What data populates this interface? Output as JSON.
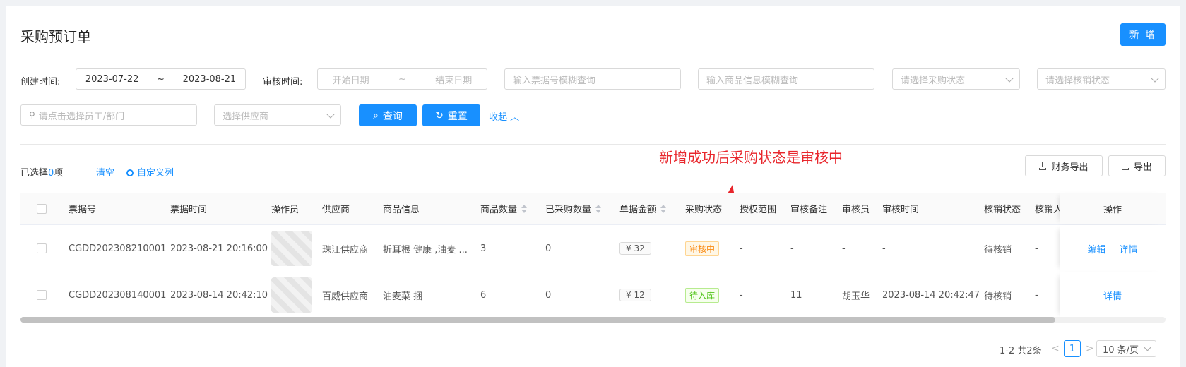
{
  "header": {
    "title": "采购预订单",
    "new_button": "新 增"
  },
  "filters": {
    "created_label": "创建时间:",
    "created_start": "2023-07-22",
    "created_end": "2023-08-21",
    "range_sep": "~",
    "audit_label": "审核时间:",
    "audit_start_placeholder": "开始日期",
    "audit_end_placeholder": "结束日期",
    "ticket_placeholder": "输入票据号模糊查询",
    "goods_placeholder": "输入商品信息模糊查询",
    "purchase_status_placeholder": "请选择采购状态",
    "writeoff_status_placeholder": "请选择核销状态",
    "employee_placeholder": "请点击选择员工/部门",
    "supplier_placeholder": "选择供应商",
    "query_button": "查询",
    "reset_button": "重置",
    "collapse_link": "收起"
  },
  "annotation": "新增成功后采购状态是审核中",
  "toolbar": {
    "selected_prefix": "已选择",
    "selected_count": "0",
    "selected_suffix": "项",
    "clear_link": "清空",
    "custom_columns_link": "自定义列",
    "finance_export_button": "财务导出",
    "export_button": "导出"
  },
  "table": {
    "columns": [
      "票据号",
      "票据时间",
      "操作员",
      "供应商",
      "商品信息",
      "商品数量",
      "已采购数量",
      "单据金额",
      "采购状态",
      "授权范围",
      "审核备注",
      "审核员",
      "审核时间",
      "核销状态",
      "核销人",
      "操作"
    ],
    "rows": [
      {
        "ticket": "CGDD202308210001",
        "time": "2023-08-21 20:16:00",
        "supplier": "珠江供应商",
        "goods": "折耳根 健康 ,油麦 ...",
        "qty": "3",
        "purchased": "0",
        "amount": "¥ 32",
        "status": "审核中",
        "scope": "-",
        "remark": "-",
        "auditor": "-",
        "audit_time": "-",
        "writeoff": "待核销",
        "writeoff_by": "-",
        "op_edit": "编辑",
        "op_detail": "详情"
      },
      {
        "ticket": "CGDD202308140001",
        "time": "2023-08-14 20:42:10",
        "supplier": "百威供应商",
        "goods": "油麦菜 捆",
        "qty": "6",
        "purchased": "0",
        "amount": "¥ 12",
        "status": "待入库",
        "scope": "-",
        "remark": "11",
        "auditor": "胡玉华",
        "audit_time": "2023-08-14 20:42:47",
        "writeoff": "待核销",
        "writeoff_by": "-",
        "op_detail": "详情"
      }
    ]
  },
  "pagination": {
    "total": "1-2 共2条",
    "prev": "<",
    "current": "1",
    "next": ">",
    "page_size": "10 条/页"
  },
  "colors": {
    "primary": "#1890ff",
    "annotation": "#e8262c",
    "tag_orange": "#fa8c16",
    "tag_green": "#52c41a"
  }
}
